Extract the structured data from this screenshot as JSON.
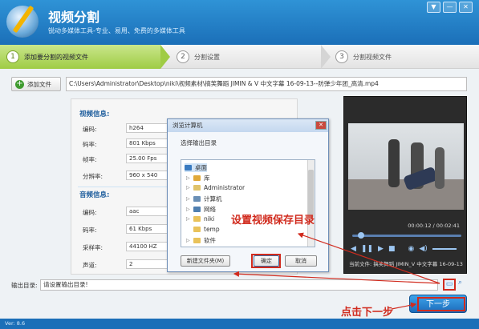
{
  "app": {
    "title": "视频分割",
    "subtitle": "锐动多媒体工具-专业、易用、免费的多媒体工具",
    "version": "Ver: 8.6",
    "window_buttons": [
      "▼",
      "—",
      "✕"
    ]
  },
  "steps": [
    {
      "num": "1",
      "label": "添加要分割的视频文件",
      "active": true
    },
    {
      "num": "2",
      "label": "分割设置",
      "active": false
    },
    {
      "num": "3",
      "label": "分割视频文件",
      "active": false
    }
  ],
  "file": {
    "add_label": "添加文件",
    "path": "C:\\Users\\Administrator\\Desktop\\niki\\视频素材\\搞笑舞蹈 JIMIN & V 中文字幕 16-09-13--防弹少年团_高清.mp4"
  },
  "video_info": {
    "title": "视频信息:",
    "rows": [
      {
        "label": "编码:",
        "value": "h264"
      },
      {
        "label": "码率:",
        "value": "801 Kbps"
      },
      {
        "label": "帧率:",
        "value": "25.00 Fps"
      },
      {
        "label": "分辨率:",
        "value": "960 x 540"
      }
    ]
  },
  "audio_info": {
    "title": "音频信息:",
    "rows": [
      {
        "label": "编码:",
        "value": "aac"
      },
      {
        "label": "码率:",
        "value": "61 Kbps"
      },
      {
        "label": "采样率:",
        "value": "44100 HZ"
      },
      {
        "label": "声道:",
        "value": "2"
      }
    ]
  },
  "preview": {
    "timecode": "00:00:12 / 00:02:41",
    "current_file": "当前文件: 搞笑舞蹈 JIMIN_V 中文字幕 16-09-13",
    "progress": 0.08
  },
  "output": {
    "label": "输出目录:",
    "placeholder": "请设置输出目录!"
  },
  "next_button": "下一步",
  "dialog": {
    "title": "浏览计算机",
    "prompt": "选择输出目录",
    "tree": [
      {
        "label": "桌面",
        "level": 0,
        "icon": "desktop-icon",
        "color": "#3a7bc0",
        "selected": true
      },
      {
        "label": "库",
        "level": 1,
        "icon": "library-icon",
        "color": "#e0a93a"
      },
      {
        "label": "Administrator",
        "level": 1,
        "icon": "user-folder-icon",
        "color": "#e0c36a"
      },
      {
        "label": "计算机",
        "level": 1,
        "icon": "computer-icon",
        "color": "#6a8fb5"
      },
      {
        "label": "网络",
        "level": 1,
        "icon": "network-icon",
        "color": "#4f7fb0"
      },
      {
        "label": "niki",
        "level": 1,
        "icon": "folder-icon",
        "color": "#e9c25a"
      },
      {
        "label": "temp",
        "level": 1,
        "icon": "folder-icon",
        "color": "#e9c25a"
      },
      {
        "label": "软件",
        "level": 1,
        "icon": "folder-icon",
        "color": "#e9c25a"
      }
    ],
    "new_folder": "新建文件夹(M)",
    "ok": "确定",
    "cancel": "取消"
  },
  "annotations": {
    "set_folder": "设置视频保存目录",
    "click_next": "点击下一步"
  }
}
